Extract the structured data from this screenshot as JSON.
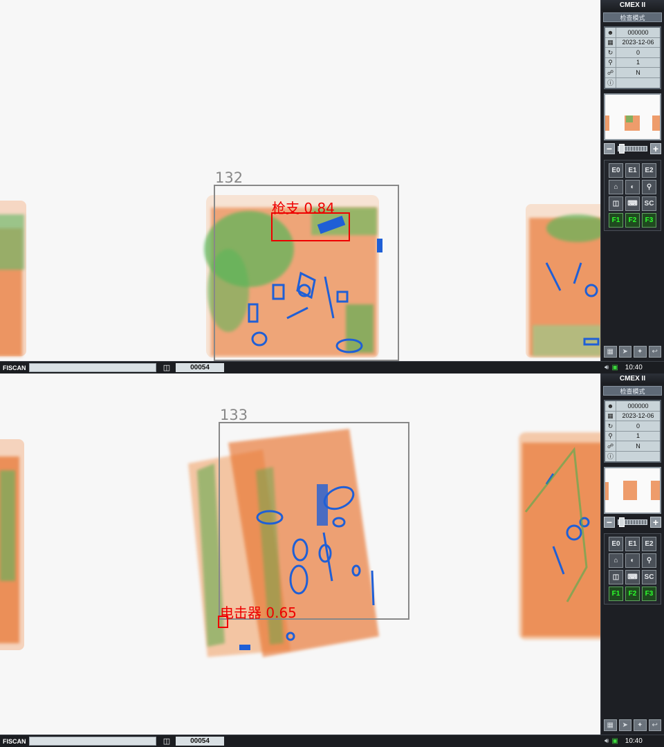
{
  "screens": [
    {
      "id": "top",
      "app_title": "CMEX II",
      "mode_label": "检查模式",
      "info": [
        {
          "icon": "operator-icon",
          "value": "000000"
        },
        {
          "icon": "calendar-icon",
          "value": "2023-12-06"
        },
        {
          "icon": "counter-icon",
          "value": "0"
        },
        {
          "icon": "magnify-icon",
          "value": "1"
        },
        {
          "icon": "network-icon",
          "value": "N"
        },
        {
          "icon": "info-icon",
          "value": ""
        }
      ],
      "bag_number": "132",
      "detection": {
        "label": "枪支 0.84"
      },
      "buttons": [
        "E0",
        "E1",
        "E2",
        "",
        "",
        "",
        "",
        "",
        "SC",
        "F1",
        "F2",
        "F3"
      ],
      "status": {
        "brand": "FISCAN",
        "counter": "00054",
        "time": "10:40"
      }
    },
    {
      "id": "bottom",
      "app_title": "CMEX II",
      "mode_label": "检查模式",
      "info": [
        {
          "icon": "operator-icon",
          "value": "000000"
        },
        {
          "icon": "calendar-icon",
          "value": "2023-12-06"
        },
        {
          "icon": "counter-icon",
          "value": "0"
        },
        {
          "icon": "magnify-icon",
          "value": "1"
        },
        {
          "icon": "network-icon",
          "value": "N"
        },
        {
          "icon": "info-icon",
          "value": ""
        }
      ],
      "bag_number": "133",
      "detection": {
        "label": "电击器 0.65"
      },
      "buttons": [
        "E0",
        "E1",
        "E2",
        "",
        "",
        "",
        "",
        "",
        "SC",
        "F1",
        "F2",
        "F3"
      ],
      "status": {
        "brand": "FISCAN",
        "counter": "00054",
        "time": "10:40"
      }
    }
  ],
  "colors": {
    "organic": "#e8732e",
    "mixed": "#4caf50",
    "inorganic": "#1f5fd6",
    "alarm": "#e00000",
    "frame": "#888888"
  }
}
